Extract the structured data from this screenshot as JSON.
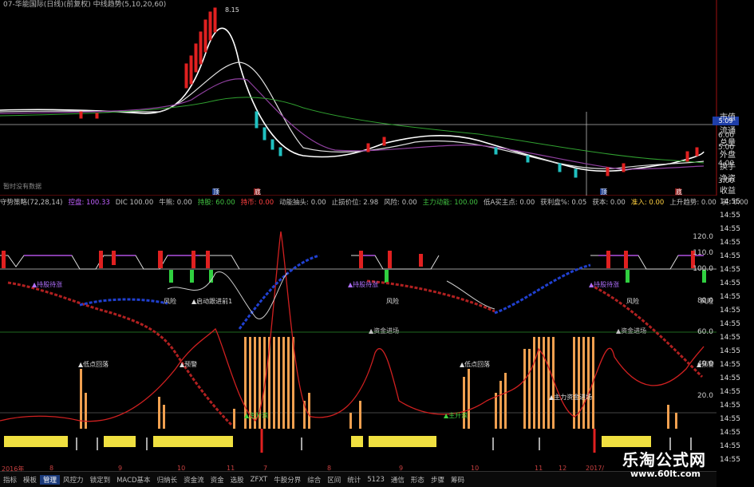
{
  "top_bar": {
    "title": "07-华能国际(日线)(前复权) 中线趋势(5,10,20,60)"
  },
  "price_pane": {
    "status_text": "暂时没有数据",
    "axis_ticks": [
      "6.00",
      "5.00",
      "4.00",
      "3.00"
    ],
    "current_price": "5.09",
    "high_label": "8.15",
    "marker_labels": [
      "顶",
      "底",
      "顶",
      "底"
    ],
    "sidebar_labels": [
      "市值",
      "流通",
      "总量",
      "外盘",
      "换手",
      "净资",
      "收益"
    ]
  },
  "param_line": {
    "items": [
      {
        "text": "守势策略(72,28,14)",
        "color": "#c0c0c0"
      },
      {
        "text": "控盘: 100.33",
        "color": "#c060ff"
      },
      {
        "text": "DIC 100.00",
        "color": "#c0c0c0"
      },
      {
        "text": "牛熊: 0.00",
        "color": "#c0c0c0"
      },
      {
        "text": "持股: 60.00",
        "color": "#40c040"
      },
      {
        "text": "持币: 0.00",
        "color": "#ff4040"
      },
      {
        "text": "动能抽头: 0.00",
        "color": "#c0c0c0"
      },
      {
        "text": "止损价位: 2.98",
        "color": "#c0c0c0"
      },
      {
        "text": "风险: 0.00",
        "color": "#c0c0c0"
      },
      {
        "text": "主力动能: 100.00",
        "color": "#40c040"
      },
      {
        "text": "低A买主点: 0.00",
        "color": "#c0c0c0"
      },
      {
        "text": "获利盘%: 0.05",
        "color": "#c0c0c0"
      },
      {
        "text": "获本: 0.00",
        "color": "#c0c0c0"
      },
      {
        "text": "准入: 0.00",
        "color": "#ffd040"
      },
      {
        "text": "上升趋势: 0.00",
        "color": "#c0c0c0"
      },
      {
        "text": "买: 0.00",
        "color": "#c0c0c0"
      }
    ]
  },
  "indicator_pane": {
    "axis_ticks": [
      "120.0",
      "110.0",
      "100.0",
      "80.0",
      "60.0",
      "40.0",
      "20.0"
    ],
    "time_labels": [
      "14:55",
      "14:55",
      "14:55",
      "14:55",
      "14:55",
      "14:55",
      "14:55",
      "14:55",
      "14:55",
      "14:55",
      "14:55",
      "14:55",
      "14:55",
      "14:55",
      "14:55",
      "14:55",
      "14:55",
      "14:55",
      "14:55",
      "14:55"
    ],
    "annotations": {
      "hold_1": "▲持股待涨",
      "hold_2": "▲持股待涨",
      "hold_3": "▲持股待涨",
      "risk_1": "风险",
      "risk_2": "风险",
      "risk_3": "风险",
      "risk_4": "风险",
      "risk_5": "风险",
      "mid_text": "▲启动跟进前1",
      "fund_1": "▲资金进场",
      "fund_2": "▲资金进场",
      "low_1": "▲低点回落",
      "low_2": "▲低点回落",
      "warn_1": "▲预警",
      "warn_2": "▲预警",
      "fund_enter": "▲主力资金进场",
      "green_1": "▲主升浪",
      "green_2": "▲主升浪"
    }
  },
  "date_axis": {
    "labels": [
      "2016年",
      "8",
      "9",
      "10",
      "11",
      "7",
      "8",
      "9",
      "10",
      "11",
      "12",
      "2017/"
    ]
  },
  "tab_bar": {
    "tabs": [
      "指标",
      "模板",
      "管理",
      "风控力",
      "锁定到",
      "MACD基本",
      "归纳长",
      "资金流",
      "资金",
      "选股",
      "ZFXT",
      "牛股分界",
      "综合",
      "区间",
      "统计",
      "5123",
      "通信",
      "形态",
      "步骤",
      "筹码"
    ],
    "active_index": 2
  },
  "watermark": {
    "site_name": "乐淘公式网",
    "url": "www.60lt.com"
  }
}
